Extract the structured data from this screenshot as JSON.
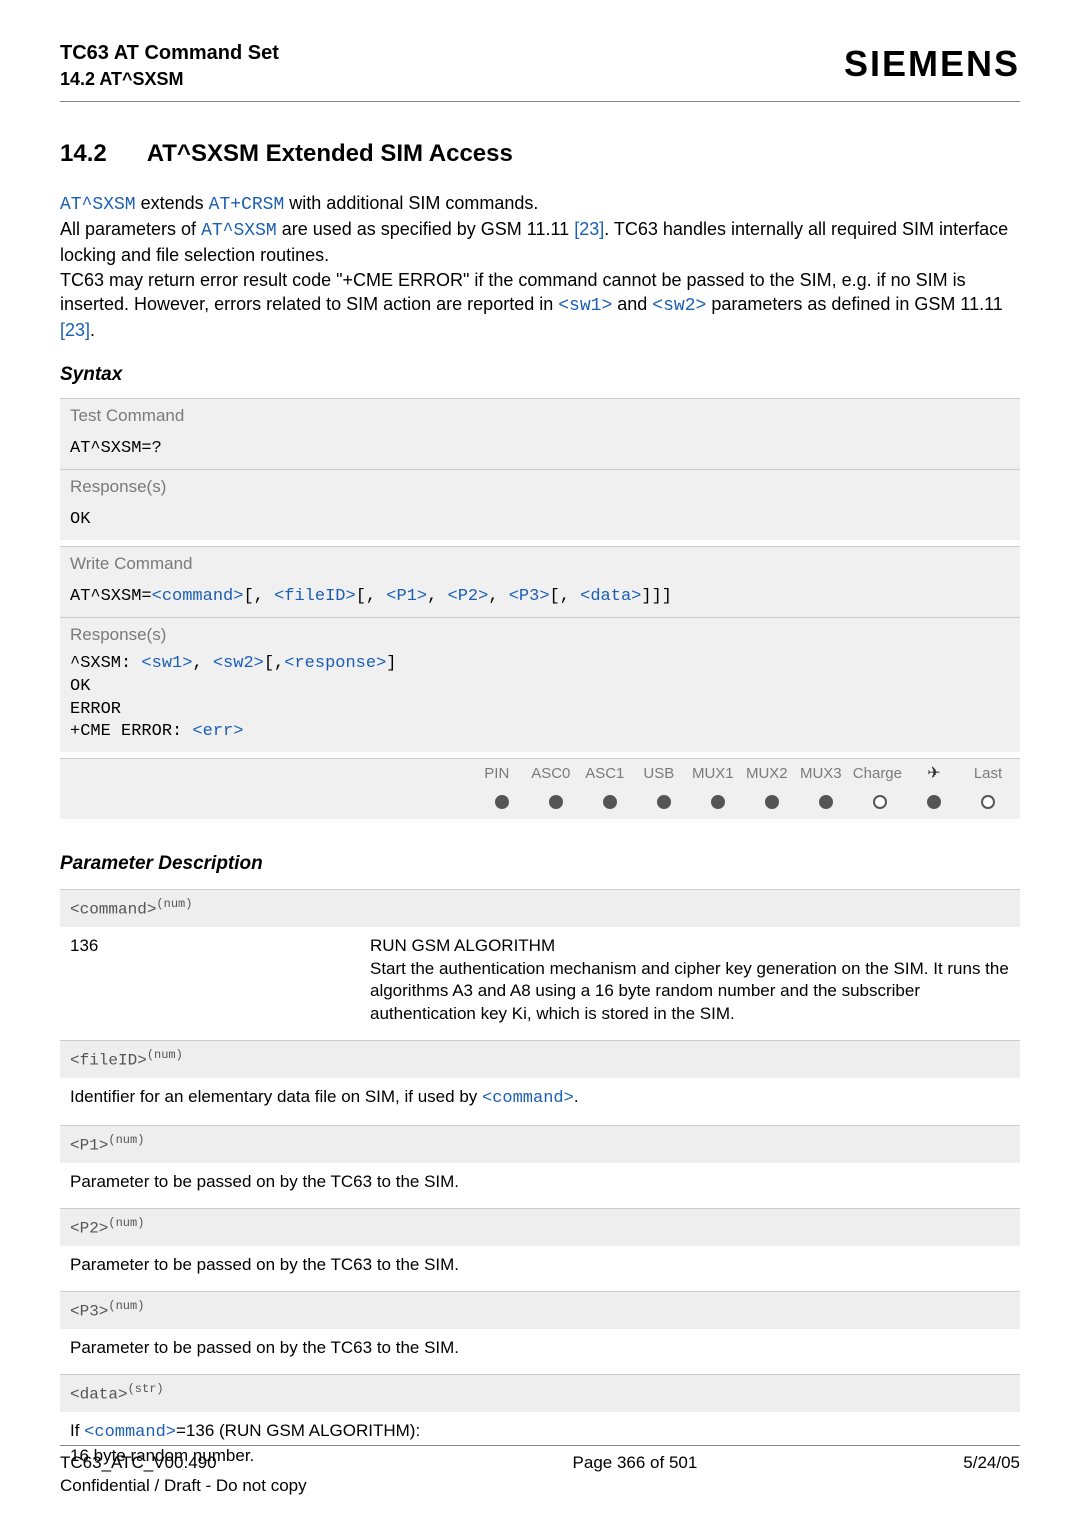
{
  "header": {
    "title": "TC63 AT Command Set",
    "subtitle": "14.2 AT^SXSM",
    "brand": "SIEMENS"
  },
  "section": {
    "number": "14.2",
    "title": "AT^SXSM   Extended SIM Access"
  },
  "intro": {
    "l1a": "AT^SXSM",
    "l1b": " extends ",
    "l1c": "AT+CRSM",
    "l1d": " with additional SIM commands.",
    "l2a": "All parameters of ",
    "l2b": "AT^SXSM",
    "l2c": " are used as specified by GSM 11.11 ",
    "l2d": "[23]",
    "l2e": ". TC63 handles internally all required SIM interface locking and file selection routines.",
    "l3a": "TC63 may return error result code \"+CME ERROR\" if the command cannot be passed to the SIM, e.g. if no SIM is inserted. However, errors related to SIM action are reported in ",
    "l3b": "<sw1>",
    "l3c": " and ",
    "l3d": "<sw2>",
    "l3e": " parameters as defined in GSM 11.11 ",
    "l3f": "[23]",
    "l3g": "."
  },
  "syntax": {
    "heading": "Syntax",
    "test_label": "Test Command",
    "test_cmd": "AT^SXSM=?",
    "resp_label": "Response(s)",
    "ok": "OK",
    "write_label": "Write Command",
    "write_cmd_prefix": "AT^SXSM=",
    "write_params": {
      "p1": "<command>",
      "b1": "[, ",
      "p2": "<fileID>",
      "b2": "[, ",
      "p3": "<P1>",
      "b3": ", ",
      "p4": "<P2>",
      "b4": ", ",
      "p5": "<P3>",
      "b5": "[, ",
      "p6": "<data>",
      "b6": "]]]"
    },
    "write_resp_prefix": "^SXSM: ",
    "write_resp": {
      "r1": "<sw1>",
      "c1": ", ",
      "r2": "<sw2>",
      "c2": "[,",
      "r3": "<response>",
      "c3": "]"
    },
    "error": "ERROR",
    "cme_prefix": "+CME ERROR: ",
    "cme_err": "<err>"
  },
  "interfaces": {
    "cols": [
      "PIN",
      "ASC0",
      "ASC1",
      "USB",
      "MUX1",
      "MUX2",
      "MUX3",
      "Charge",
      "✈",
      "Last"
    ]
  },
  "params": {
    "heading": "Parameter Description",
    "command": {
      "label": "<command>",
      "sup": "(num)",
      "key": "136",
      "val": "RUN GSM ALGORITHM\nStart the authentication mechanism and cipher key generation on the SIM. It runs the algorithms A3 and A8 using a 16 byte random number and the subscriber authentication key Ki, which is stored in the SIM."
    },
    "fileid": {
      "label": "<fileID>",
      "sup": "(num)",
      "desc_a": "Identifier for an elementary data file on SIM, if used by ",
      "desc_b": "<command>",
      "desc_c": "."
    },
    "p1": {
      "label": "<P1>",
      "sup": "(num)",
      "desc": "Parameter to be passed on by the TC63 to the SIM."
    },
    "p2": {
      "label": "<P2>",
      "sup": "(num)",
      "desc": "Parameter to be passed on by the TC63 to the SIM."
    },
    "p3": {
      "label": "<P3>",
      "sup": "(num)",
      "desc": "Parameter to be passed on by the TC63 to the SIM."
    },
    "pdata": {
      "label": "<data>",
      "sup": "(str)",
      "desc_a": "If ",
      "desc_b": "<command>",
      "desc_c": "=136 (RUN GSM ALGORITHM):",
      "desc_d": "16 byte random number."
    }
  },
  "footer": {
    "left1": "TC63_ATC_V00.490",
    "left2": "Confidential / Draft - Do not copy",
    "center": "Page 366 of 501",
    "right": "5/24/05"
  }
}
